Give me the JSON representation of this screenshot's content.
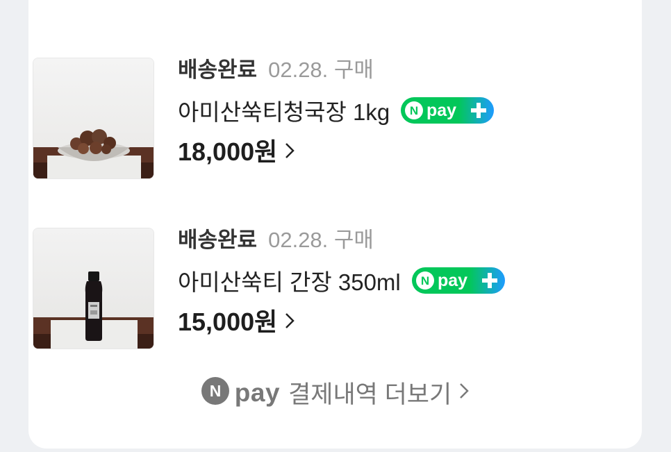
{
  "orders": [
    {
      "status": "배송완료",
      "date": "02.28. 구매",
      "name": "아미산쑥티청국장 1kg",
      "price": "18,000원",
      "badge": "npay+",
      "thumb_icon": "soybean-balls-bowl-photo"
    },
    {
      "status": "배송완료",
      "date": "02.28. 구매",
      "name": "아미산쑥티 간장 350ml",
      "price": "15,000원",
      "badge": "npay+",
      "thumb_icon": "soy-sauce-bottle-photo"
    }
  ],
  "more": {
    "brand": "pay",
    "label": "결제내역 더보기"
  },
  "colors": {
    "npay_green": "#03c75a",
    "npay_blue": "#1e9bff",
    "status_text": "#333333",
    "muted_text": "#9a9a9a"
  }
}
